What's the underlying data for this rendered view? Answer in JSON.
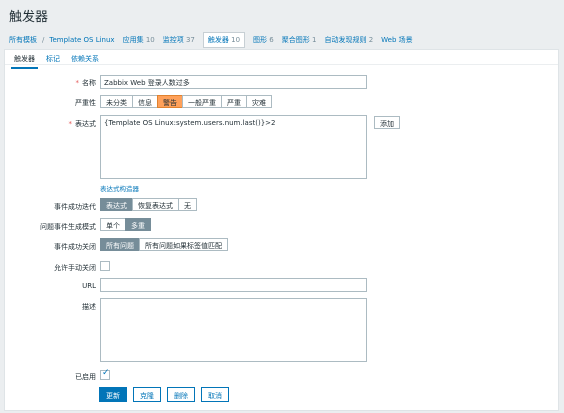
{
  "page_title": "触发器",
  "breadcrumb": {
    "all_templates": "所有模板",
    "separator": "/",
    "template_name": "Template OS Linux",
    "items": [
      {
        "label": "应用集",
        "count": "10"
      },
      {
        "label": "监控项",
        "count": "37"
      },
      {
        "label": "触发器",
        "count": "10"
      },
      {
        "label": "图形",
        "count": "6"
      },
      {
        "label": "聚合图形",
        "count": "1"
      },
      {
        "label": "自动发现规则",
        "count": "2"
      },
      {
        "label": "Web 场景",
        "count": ""
      }
    ]
  },
  "tabs": [
    "触发器",
    "标记",
    "依赖关系"
  ],
  "form": {
    "name_label": "名称",
    "name_value": "Zabbix Web 登录人数过多",
    "severity_label": "严重性",
    "severity_options": [
      "未分类",
      "信息",
      "警告",
      "一般严重",
      "严重",
      "灾难"
    ],
    "severity_selected": "警告",
    "expression_label": "表达式",
    "expression_value": "{Template OS Linux:system.users.num.last()}>2",
    "add_button": "添加",
    "expression_builder": "表达式构造器",
    "event_gen_label": "事件成功迭代",
    "event_gen_options": [
      "表达式",
      "恢复表达式",
      "无"
    ],
    "event_gen_selected": "表达式",
    "problem_mode_label": "问题事件生成模式",
    "problem_mode_options": [
      "单个",
      "多重"
    ],
    "problem_mode_selected": "多重",
    "ok_close_label": "事件成功关闭",
    "ok_close_options": [
      "所有问题",
      "所有问题如果标签值匹配"
    ],
    "ok_close_selected": "所有问题",
    "manual_close_label": "允许手动关闭",
    "url_label": "URL",
    "url_value": "",
    "desc_label": "描述",
    "desc_value": "",
    "enabled_label": "已启用",
    "enabled": true
  },
  "actions": [
    "更新",
    "克隆",
    "删除",
    "取消"
  ],
  "colors": {
    "accent": "#0275b8",
    "warning": "#ffa059",
    "selected_gray": "#768d99"
  }
}
